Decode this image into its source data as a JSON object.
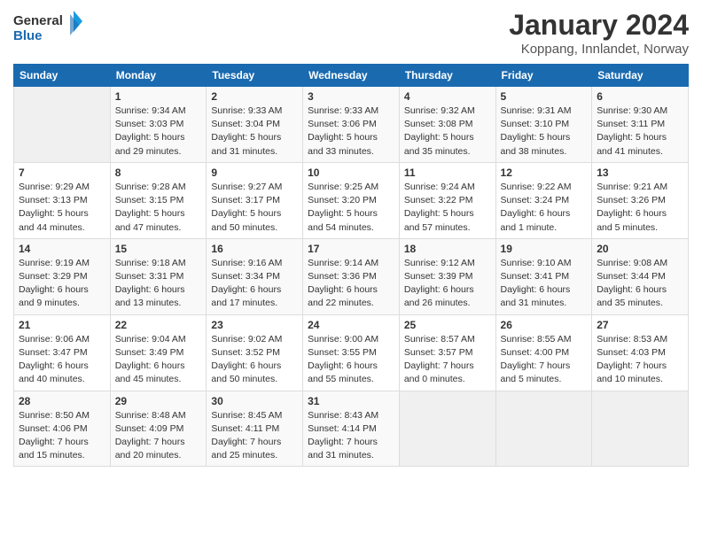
{
  "header": {
    "logo_line1": "General",
    "logo_line2": "Blue",
    "month": "January 2024",
    "location": "Koppang, Innlandet, Norway"
  },
  "weekdays": [
    "Sunday",
    "Monday",
    "Tuesday",
    "Wednesday",
    "Thursday",
    "Friday",
    "Saturday"
  ],
  "weeks": [
    [
      {
        "day": "",
        "info": ""
      },
      {
        "day": "1",
        "info": "Sunrise: 9:34 AM\nSunset: 3:03 PM\nDaylight: 5 hours\nand 29 minutes."
      },
      {
        "day": "2",
        "info": "Sunrise: 9:33 AM\nSunset: 3:04 PM\nDaylight: 5 hours\nand 31 minutes."
      },
      {
        "day": "3",
        "info": "Sunrise: 9:33 AM\nSunset: 3:06 PM\nDaylight: 5 hours\nand 33 minutes."
      },
      {
        "day": "4",
        "info": "Sunrise: 9:32 AM\nSunset: 3:08 PM\nDaylight: 5 hours\nand 35 minutes."
      },
      {
        "day": "5",
        "info": "Sunrise: 9:31 AM\nSunset: 3:10 PM\nDaylight: 5 hours\nand 38 minutes."
      },
      {
        "day": "6",
        "info": "Sunrise: 9:30 AM\nSunset: 3:11 PM\nDaylight: 5 hours\nand 41 minutes."
      }
    ],
    [
      {
        "day": "7",
        "info": "Sunrise: 9:29 AM\nSunset: 3:13 PM\nDaylight: 5 hours\nand 44 minutes."
      },
      {
        "day": "8",
        "info": "Sunrise: 9:28 AM\nSunset: 3:15 PM\nDaylight: 5 hours\nand 47 minutes."
      },
      {
        "day": "9",
        "info": "Sunrise: 9:27 AM\nSunset: 3:17 PM\nDaylight: 5 hours\nand 50 minutes."
      },
      {
        "day": "10",
        "info": "Sunrise: 9:25 AM\nSunset: 3:20 PM\nDaylight: 5 hours\nand 54 minutes."
      },
      {
        "day": "11",
        "info": "Sunrise: 9:24 AM\nSunset: 3:22 PM\nDaylight: 5 hours\nand 57 minutes."
      },
      {
        "day": "12",
        "info": "Sunrise: 9:22 AM\nSunset: 3:24 PM\nDaylight: 6 hours\nand 1 minute."
      },
      {
        "day": "13",
        "info": "Sunrise: 9:21 AM\nSunset: 3:26 PM\nDaylight: 6 hours\nand 5 minutes."
      }
    ],
    [
      {
        "day": "14",
        "info": "Sunrise: 9:19 AM\nSunset: 3:29 PM\nDaylight: 6 hours\nand 9 minutes."
      },
      {
        "day": "15",
        "info": "Sunrise: 9:18 AM\nSunset: 3:31 PM\nDaylight: 6 hours\nand 13 minutes."
      },
      {
        "day": "16",
        "info": "Sunrise: 9:16 AM\nSunset: 3:34 PM\nDaylight: 6 hours\nand 17 minutes."
      },
      {
        "day": "17",
        "info": "Sunrise: 9:14 AM\nSunset: 3:36 PM\nDaylight: 6 hours\nand 22 minutes."
      },
      {
        "day": "18",
        "info": "Sunrise: 9:12 AM\nSunset: 3:39 PM\nDaylight: 6 hours\nand 26 minutes."
      },
      {
        "day": "19",
        "info": "Sunrise: 9:10 AM\nSunset: 3:41 PM\nDaylight: 6 hours\nand 31 minutes."
      },
      {
        "day": "20",
        "info": "Sunrise: 9:08 AM\nSunset: 3:44 PM\nDaylight: 6 hours\nand 35 minutes."
      }
    ],
    [
      {
        "day": "21",
        "info": "Sunrise: 9:06 AM\nSunset: 3:47 PM\nDaylight: 6 hours\nand 40 minutes."
      },
      {
        "day": "22",
        "info": "Sunrise: 9:04 AM\nSunset: 3:49 PM\nDaylight: 6 hours\nand 45 minutes."
      },
      {
        "day": "23",
        "info": "Sunrise: 9:02 AM\nSunset: 3:52 PM\nDaylight: 6 hours\nand 50 minutes."
      },
      {
        "day": "24",
        "info": "Sunrise: 9:00 AM\nSunset: 3:55 PM\nDaylight: 6 hours\nand 55 minutes."
      },
      {
        "day": "25",
        "info": "Sunrise: 8:57 AM\nSunset: 3:57 PM\nDaylight: 7 hours\nand 0 minutes."
      },
      {
        "day": "26",
        "info": "Sunrise: 8:55 AM\nSunset: 4:00 PM\nDaylight: 7 hours\nand 5 minutes."
      },
      {
        "day": "27",
        "info": "Sunrise: 8:53 AM\nSunset: 4:03 PM\nDaylight: 7 hours\nand 10 minutes."
      }
    ],
    [
      {
        "day": "28",
        "info": "Sunrise: 8:50 AM\nSunset: 4:06 PM\nDaylight: 7 hours\nand 15 minutes."
      },
      {
        "day": "29",
        "info": "Sunrise: 8:48 AM\nSunset: 4:09 PM\nDaylight: 7 hours\nand 20 minutes."
      },
      {
        "day": "30",
        "info": "Sunrise: 8:45 AM\nSunset: 4:11 PM\nDaylight: 7 hours\nand 25 minutes."
      },
      {
        "day": "31",
        "info": "Sunrise: 8:43 AM\nSunset: 4:14 PM\nDaylight: 7 hours\nand 31 minutes."
      },
      {
        "day": "",
        "info": ""
      },
      {
        "day": "",
        "info": ""
      },
      {
        "day": "",
        "info": ""
      }
    ]
  ]
}
